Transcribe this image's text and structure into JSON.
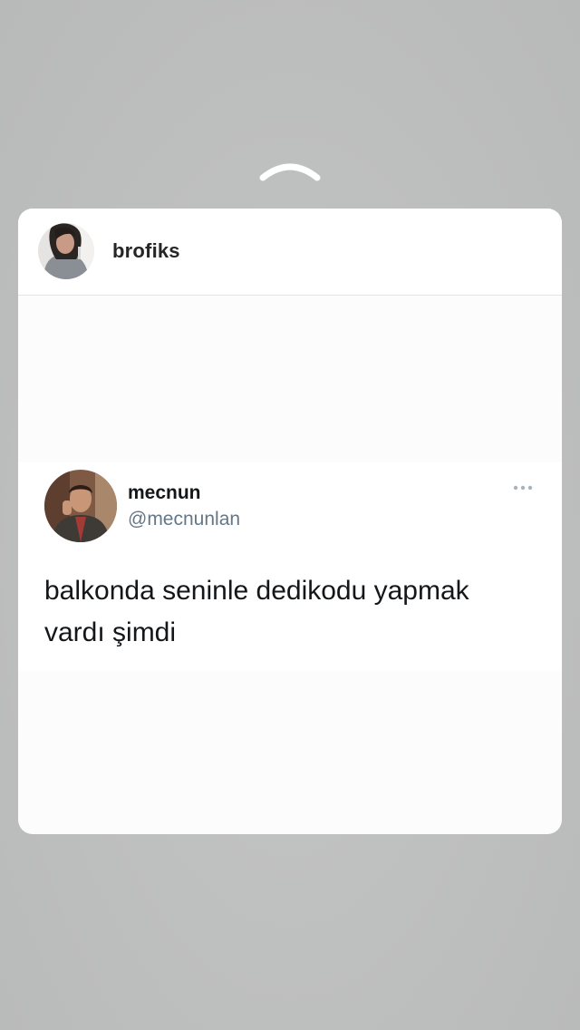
{
  "post": {
    "username": "brofiks"
  },
  "tweet": {
    "name": "mecnun",
    "handle": "@mecnunlan",
    "text": "balkonda seninle dedikodu yapmak vardı şimdi",
    "more_icon": "more-horizontal-icon"
  },
  "colors": {
    "background": "#bebfbf",
    "card": "#fcfcfc",
    "tweet_name": "#14171a",
    "tweet_handle": "#657786"
  }
}
